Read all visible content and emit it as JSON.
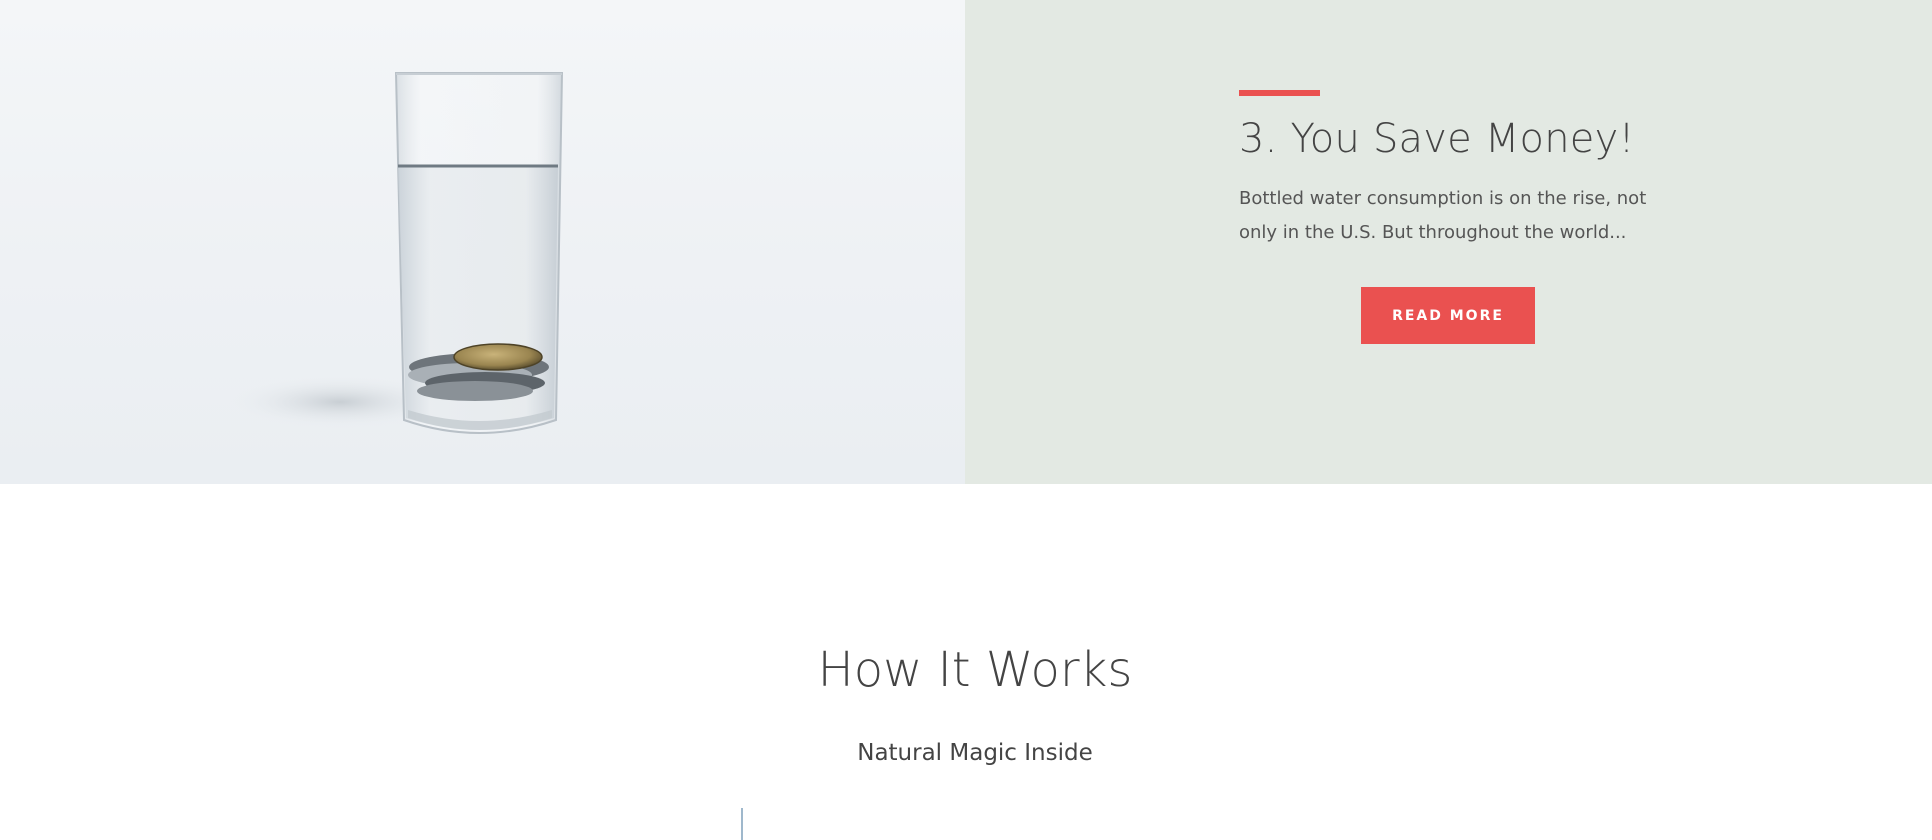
{
  "feature": {
    "heading": "3. You Save Money!",
    "body": "Bottled water consumption is on the rise, not only in the U.S. But throughout the world...",
    "button_label": "READ MORE",
    "image_icon": "glass-of-water-with-coins-photo"
  },
  "how_it_works": {
    "title": "How It Works",
    "subtitle": "Natural Magic Inside"
  },
  "colors": {
    "accent": "#ea5150",
    "panel_bg": "#e3e9e3",
    "text": "#444444"
  }
}
